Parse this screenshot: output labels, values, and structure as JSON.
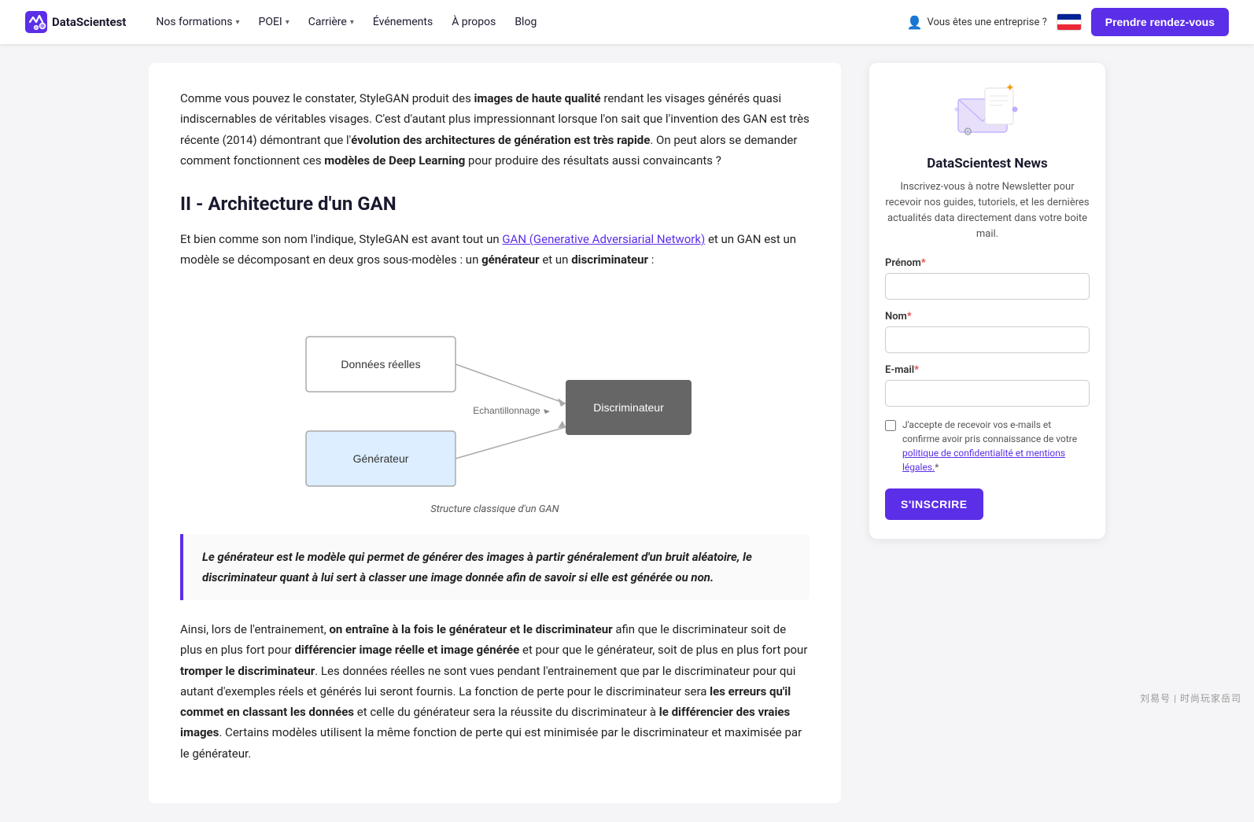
{
  "navbar": {
    "logo_text": "DataScientest",
    "nav_items": [
      {
        "label": "Nos formations",
        "has_dropdown": true
      },
      {
        "label": "POEI",
        "has_dropdown": true
      },
      {
        "label": "Carrière",
        "has_dropdown": true
      },
      {
        "label": "Événements",
        "has_dropdown": false
      },
      {
        "label": "À propos",
        "has_dropdown": false
      },
      {
        "label": "Blog",
        "has_dropdown": false
      }
    ],
    "enterprise_label": "Vous êtes une entreprise ?",
    "cta_label": "Prendre rendez-vous"
  },
  "main": {
    "intro_paragraph": "Comme vous pouvez le constater, StyleGAN produit des ",
    "intro_bold1": "images de haute qualité",
    "intro_rest": " rendant les visages générés quasi indiscernables de véritables visages. C'est d'autant plus impressionnant lorsque l'on sait que l'invention des GAN est très récente (2014) démontrant que l'",
    "intro_bold2": "évolution des architectures de génération est très rapide",
    "intro_rest2": ". On peut alors se demander comment fonctionnent ces ",
    "intro_bold3": "modèles de Deep Learning",
    "intro_rest3": " pour produire des résultats aussi convaincants ?",
    "section_title": "II - Architecture d'un GAN",
    "section_intro": "Et bien comme son nom l'indique, StyleGAN est avant tout un ",
    "section_link_text": "GAN (Generative Adversiarial Network)",
    "section_rest": " et un GAN est un modèle se décomposant en deux gros sous-modèles : un ",
    "section_bold1": "générateur",
    "section_rest2": " et un ",
    "section_bold2": "discriminateur",
    "section_rest3": " :",
    "diagram_caption": "Structure classique d'un GAN",
    "diagram_nodes": {
      "donnees": "Données réelles",
      "generateur": "Générateur",
      "echantillonnage": "Echantillonnage",
      "discriminateur": "Discriminateur"
    },
    "quote_text": "Le générateur est le modèle qui permet de générer des images à partir généralement d'un bruit aléatoire, le discriminateur quant à lui sert à classer une image donnée afin de savoir si elle est générée ou non.",
    "body_para1_start": "Ainsi, lors de l'entrainement, ",
    "body_bold1": "on entraîne à la fois le générateur et le discriminateur",
    "body_para1_mid": " afin que le discriminateur soit de plus en plus fort pour ",
    "body_bold2": "différencier image réelle et image générée",
    "body_para1_mid2": " et pour que le générateur, soit de plus en plus fort pour ",
    "body_bold3": "tromper le discriminateur",
    "body_para1_rest": ". Les données réelles ne sont vues pendant l'entrainement que par le discriminateur pour qui autant d'exemples réels et générés lui seront fournis. La fonction de perte pour le discriminateur sera ",
    "body_bold4": "les erreurs qu'il commet en classant les données",
    "body_para1_rest2": " et celle du générateur sera la réussite du discriminateur à ",
    "body_bold5": "le différencier des vraies images",
    "body_para1_end": ". Certains modèles utilisent la même fonction de perte qui est minimisée par le discriminateur et maximisée par le générateur."
  },
  "sidebar": {
    "newsletter_title": "DataScientest News",
    "newsletter_desc": "Inscrivez-vous à notre Newsletter pour recevoir nos guides, tutoriels, et les dernières actualités data directement dans votre boite mail.",
    "prenom_label": "Prénom",
    "nom_label": "Nom",
    "email_label": "E-mail",
    "required_marker": "*",
    "checkbox_text": "J'accepte de recevoir vos e-mails et confirme avoir pris connaissance de votre politique de confidentialité et mentions légales.",
    "subscribe_label": "S'INSCRIRE"
  },
  "watermark": "刘易号 | 时尚玩家岳司"
}
